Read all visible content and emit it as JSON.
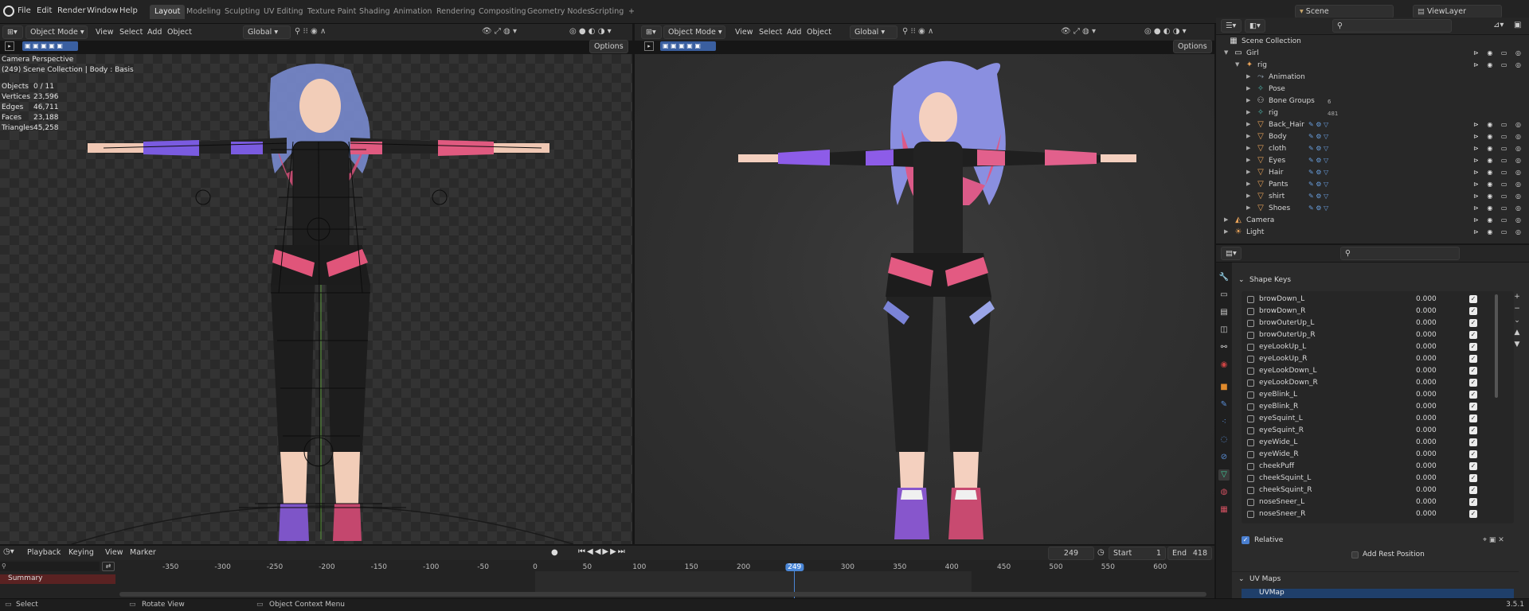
{
  "menubar": {
    "items": [
      "File",
      "Edit",
      "Render",
      "Window",
      "Help"
    ],
    "workspaces": [
      "Layout",
      "Modeling",
      "Sculpting",
      "UV Editing",
      "Texture Paint",
      "Shading",
      "Animation",
      "Rendering",
      "Compositing",
      "Geometry Nodes",
      "Scripting"
    ],
    "active_workspace": "Layout",
    "add_tab": "+",
    "scene": "Scene",
    "view_layer": "ViewLayer"
  },
  "viewport_left": {
    "mode": "Object Mode",
    "menus": [
      "View",
      "Select",
      "Add",
      "Object"
    ],
    "orientation": "Global",
    "options": "Options",
    "info_title": "Camera Perspective",
    "info_sub": "(249) Scene Collection | Body : Basis",
    "stats": [
      {
        "label": "Objects",
        "value": "0 / 11"
      },
      {
        "label": "Vertices",
        "value": "23,596"
      },
      {
        "label": "Edges",
        "value": "46,711"
      },
      {
        "label": "Faces",
        "value": "23,188"
      },
      {
        "label": "Triangles",
        "value": "45,258"
      }
    ]
  },
  "viewport_right": {
    "mode": "Object Mode",
    "menus": [
      "View",
      "Select",
      "Add",
      "Object"
    ],
    "orientation": "Global",
    "options": "Options"
  },
  "outliner": {
    "root": "Scene Collection",
    "rows": [
      {
        "label": "Girl",
        "icon": "collection-icon",
        "color": "#e0e0e0",
        "indent": 0
      },
      {
        "label": "rig",
        "icon": "armature-icon",
        "color": "#e9a35a",
        "indent": 1
      },
      {
        "label": "Animation",
        "icon": "action-icon",
        "color": "#9ab",
        "indent": 2
      },
      {
        "label": "Pose",
        "icon": "pose-icon",
        "color": "#4db6ac",
        "indent": 2
      },
      {
        "label": "Bone Groups",
        "icon": "bone-groups-icon",
        "color": "#ccc",
        "indent": 2,
        "badge": "6"
      },
      {
        "label": "rig",
        "icon": "armature-data-icon",
        "color": "#4db6ac",
        "indent": 2,
        "badge": "481"
      },
      {
        "label": "Back_Hair",
        "icon": "mesh-icon",
        "color": "#e9a35a",
        "indent": 2
      },
      {
        "label": "Body",
        "icon": "mesh-icon",
        "color": "#e9a35a",
        "indent": 2
      },
      {
        "label": "cloth",
        "icon": "mesh-icon",
        "color": "#e9a35a",
        "indent": 2
      },
      {
        "label": "Eyes",
        "icon": "mesh-icon",
        "color": "#e9a35a",
        "indent": 2
      },
      {
        "label": "Hair",
        "icon": "mesh-icon",
        "color": "#e9a35a",
        "indent": 2
      },
      {
        "label": "Pants",
        "icon": "mesh-icon",
        "color": "#e9a35a",
        "indent": 2
      },
      {
        "label": "shirt",
        "icon": "mesh-icon",
        "color": "#e9a35a",
        "indent": 2
      },
      {
        "label": "Shoes",
        "icon": "mesh-icon",
        "color": "#e9a35a",
        "indent": 2
      },
      {
        "label": "Camera",
        "icon": "camera-icon",
        "color": "#e9a35a",
        "indent": 0
      },
      {
        "label": "Light",
        "icon": "light-icon",
        "color": "#e9a35a",
        "indent": 0
      }
    ]
  },
  "properties": {
    "shape_keys_title": "Shape Keys",
    "shape_keys": [
      {
        "name": "browDown_L",
        "value": "0.000"
      },
      {
        "name": "browDown_R",
        "value": "0.000"
      },
      {
        "name": "browOuterUp_L",
        "value": "0.000"
      },
      {
        "name": "browOuterUp_R",
        "value": "0.000"
      },
      {
        "name": "eyeLookUp_L",
        "value": "0.000"
      },
      {
        "name": "eyeLookUp_R",
        "value": "0.000"
      },
      {
        "name": "eyeLookDown_L",
        "value": "0.000"
      },
      {
        "name": "eyeLookDown_R",
        "value": "0.000"
      },
      {
        "name": "eyeBlink_L",
        "value": "0.000"
      },
      {
        "name": "eyeBlink_R",
        "value": "0.000"
      },
      {
        "name": "eyeSquint_L",
        "value": "0.000"
      },
      {
        "name": "eyeSquint_R",
        "value": "0.000"
      },
      {
        "name": "eyeWide_L",
        "value": "0.000"
      },
      {
        "name": "eyeWide_R",
        "value": "0.000"
      },
      {
        "name": "cheekPuff",
        "value": "0.000"
      },
      {
        "name": "cheekSquint_L",
        "value": "0.000"
      },
      {
        "name": "cheekSquint_R",
        "value": "0.000"
      },
      {
        "name": "noseSneer_L",
        "value": "0.000"
      },
      {
        "name": "noseSneer_R",
        "value": "0.000"
      }
    ],
    "relative_label": "Relative",
    "add_rest_label": "Add Rest Position",
    "uv_maps_title": "UV Maps",
    "uv_map_name": "UVMap"
  },
  "timeline": {
    "menus": [
      "Playback",
      "Keying",
      "View",
      "Marker"
    ],
    "current_frame": "249",
    "start_label": "Start",
    "start": "1",
    "end_label": "End",
    "end": "418",
    "summary_label": "Summary",
    "ticks": [
      "-350",
      "-300",
      "-250",
      "-200",
      "-150",
      "-100",
      "-50",
      "0",
      "50",
      "100",
      "150",
      "200",
      "249",
      "300",
      "350",
      "400",
      "450",
      "500",
      "550",
      "600"
    ]
  },
  "statusbar": {
    "select": "Select",
    "rotate": "Rotate View",
    "context": "Object Context Menu",
    "version": "3.5.1"
  }
}
